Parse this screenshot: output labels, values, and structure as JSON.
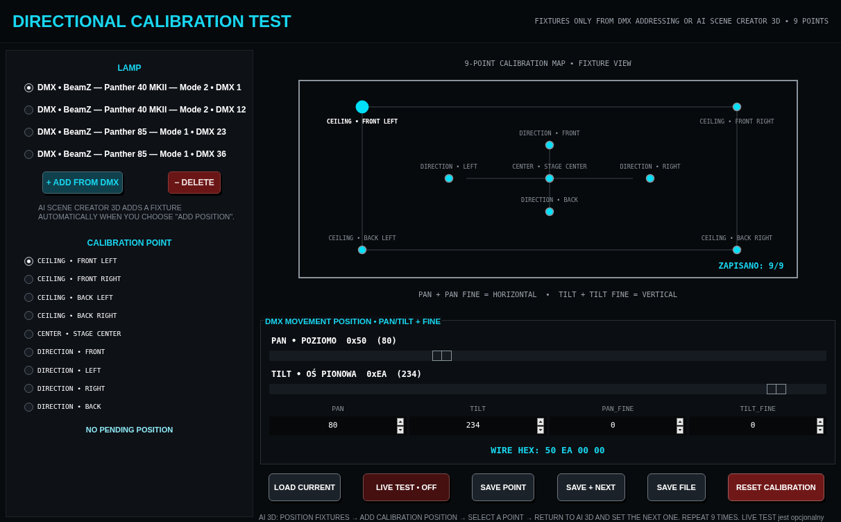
{
  "header": {
    "title": "DIRECTIONAL CALIBRATION TEST",
    "subtitle": "FIXTURES ONLY FROM DMX ADDRESSING OR AI SCENE CREATOR 3D • 9 POINTS"
  },
  "lamp_panel": {
    "title": "LAMP",
    "lamps": [
      {
        "label": "DMX • BeamZ — Panther 40 MKII — Mode 2 • DMX 1",
        "selected": true
      },
      {
        "label": "DMX • BeamZ — Panther 40 MKII — Mode 2 • DMX 12",
        "selected": false
      },
      {
        "label": "DMX • BeamZ — Panther 85 — Mode 1 • DMX 23",
        "selected": false
      },
      {
        "label": "DMX • BeamZ — Panther 85 — Mode 1 • DMX 36",
        "selected": false
      }
    ],
    "buttons": [
      {
        "label": "+ ADD FROM DMX",
        "kind": "add"
      },
      {
        "label": "− DELETE",
        "kind": "danger"
      }
    ],
    "note": "AI SCENE CREATOR 3D ADDS A FIXTURE AUTOMATICALLY WHEN YOU CHOOSE \"ADD POSITION\"."
  },
  "calibration_panel": {
    "title": "CALIBRATION POINT",
    "points": [
      {
        "label": "CEILING • FRONT LEFT",
        "selected": true
      },
      {
        "label": "CEILING • FRONT RIGHT",
        "selected": false
      },
      {
        "label": "CEILING • BACK LEFT",
        "selected": false
      },
      {
        "label": "CEILING • BACK RIGHT",
        "selected": false
      },
      {
        "label": "CENTER • STAGE CENTER",
        "selected": false
      },
      {
        "label": "DIRECTION • FRONT",
        "selected": false
      },
      {
        "label": "DIRECTION • LEFT",
        "selected": false
      },
      {
        "label": "DIRECTION • RIGHT",
        "selected": false
      },
      {
        "label": "DIRECTION • BACK",
        "selected": false
      }
    ],
    "status": "NO PENDING POSITION"
  },
  "map": {
    "title": "9-POINT CALIBRATION MAP • FIXTURE VIEW",
    "points": [
      {
        "label": "CEILING • FRONT LEFT",
        "selected": true
      },
      {
        "label": "CEILING • FRONT RIGHT",
        "selected": false
      },
      {
        "label": "DIRECTION • FRONT",
        "selected": false
      },
      {
        "label": "DIRECTION • LEFT",
        "selected": false
      },
      {
        "label": "CENTER • STAGE CENTER",
        "selected": false
      },
      {
        "label": "DIRECTION • RIGHT",
        "selected": false
      },
      {
        "label": "DIRECTION • BACK",
        "selected": false
      },
      {
        "label": "CEILING • BACK LEFT",
        "selected": false
      },
      {
        "label": "CEILING • BACK RIGHT",
        "selected": false
      }
    ],
    "saved": "ZAPISANO: 9/9",
    "legend": "PAN + PAN FINE = HORIZONTAL  •  TILT + TILT FINE = VERTICAL"
  },
  "movement": {
    "title": "DMX MOVEMENT POSITION • PAN/TILT + FINE",
    "sliders": [
      {
        "label": "PAN • POZIOMO  0x50  (80)",
        "level": 0.31
      },
      {
        "label": "TILT • OŚ PIONOWA  0xEA  (234)",
        "level": 0.91
      }
    ],
    "fields": [
      {
        "label": "PAN",
        "value": "80"
      },
      {
        "label": "TILT",
        "value": "234"
      },
      {
        "label": "PAN_FINE",
        "value": "0"
      },
      {
        "label": "TILT_FINE",
        "value": "0"
      }
    ],
    "wire_hex": "WIRE HEX: 50 EA 00 00"
  },
  "actions": [
    {
      "label": "LOAD CURRENT",
      "kind": "normal"
    },
    {
      "label": "LIVE TEST • OFF",
      "kind": "live"
    },
    {
      "label": "SAVE POINT",
      "kind": "normal"
    },
    {
      "label": "SAVE + NEXT",
      "kind": "normal"
    },
    {
      "label": "SAVE FILE",
      "kind": "normal"
    },
    {
      "label": "RESET CALIBRATION",
      "kind": "danger"
    }
  ],
  "footer": "AI 3D: POSITION FIXTURES → ADD CALIBRATION POSITION → SELECT A POINT → RETURN TO AI 3D AND SET THE NEXT ONE. REPEAT 9 TIMES. LIVE TEST jest opcjonalny"
}
